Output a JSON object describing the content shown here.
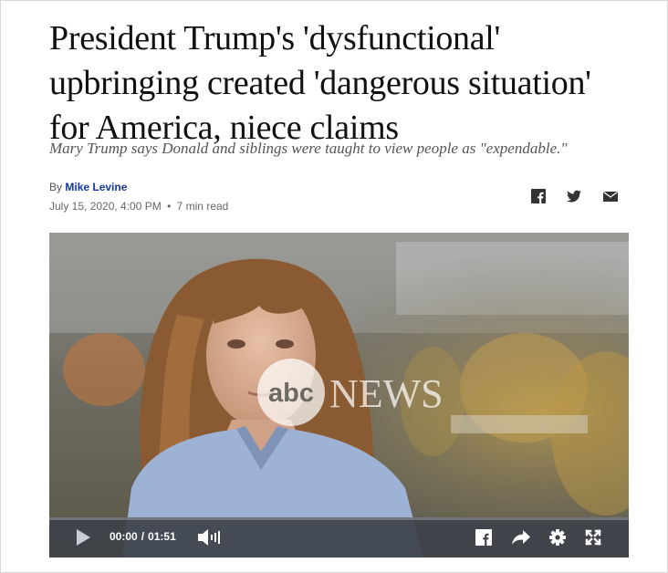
{
  "article": {
    "headline_lines": [
      "President Trump's 'dysfunctional'",
      "upbringing created 'dangerous situation'",
      "for America, niece claims"
    ],
    "subheadline": "Mary Trump says Donald and siblings were taught to view people as \"expendable.\"",
    "by_label": "By",
    "author": "Mike Levine",
    "date": "July 15, 2020, 4:00 PM",
    "separator": "•",
    "read_time": "7 min read"
  },
  "share": {
    "icons": [
      "facebook-icon",
      "twitter-icon",
      "email-icon"
    ]
  },
  "video": {
    "watermark": "abcNEWS",
    "current_time": "0:00",
    "current_time_display": "00:00",
    "time_separator": "/",
    "duration": "01:51",
    "progress_fraction": 0,
    "control_icons": [
      "play-icon",
      "volume-icon",
      "facebook-icon",
      "share-arrow-icon",
      "gear-icon",
      "fullscreen-icon"
    ]
  },
  "colors": {
    "author_link": "#13389c",
    "headline": "#111111",
    "subheadline": "#555555",
    "control_bar": "#3e424a"
  }
}
